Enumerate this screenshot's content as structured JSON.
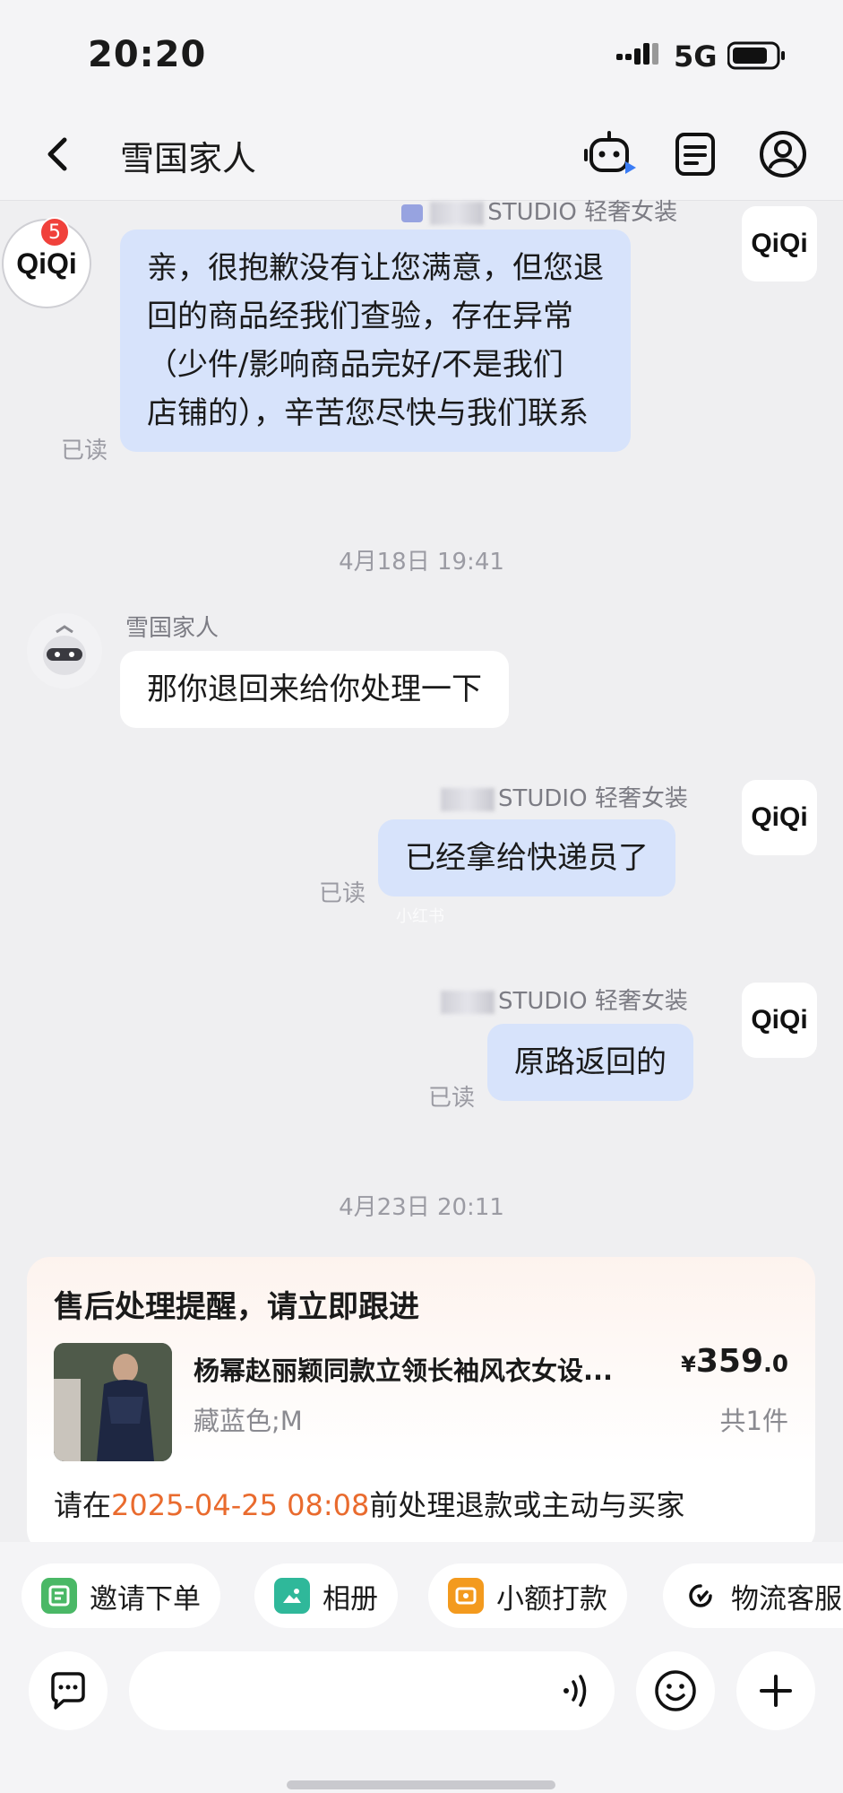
{
  "status_bar": {
    "time": "20:20",
    "network": "5G"
  },
  "nav": {
    "title": "雪国家人"
  },
  "messages": {
    "m1": {
      "sender": "STUDIO 轻奢女装",
      "avatar": "QiQi",
      "badge": "5",
      "text": [
        "亲，很抱歉没有让您满意，但您退",
        "回的商品经我们查验，存在异常",
        "（少件/影响商品完好/不是我们",
        "店铺的），辛苦您尽快与我们联系"
      ],
      "read": "已读"
    },
    "time1": "4月18日 19:41",
    "m2": {
      "sender": "雪国家人",
      "text": "那你退回来给你处理一下"
    },
    "m3": {
      "sender": "STUDIO 轻奢女装",
      "avatar": "QiQi",
      "text": "已经拿给快递员了",
      "read": "已读"
    },
    "watermark": "小红书",
    "m4": {
      "sender": "STUDIO 轻奢女装",
      "avatar": "QiQi",
      "text": "原路返回的",
      "read": "已读"
    },
    "time2": "4月23日 20:11"
  },
  "card": {
    "title": "售后处理提醒，请立即跟进",
    "product_name": "杨幂赵丽颖同款立领长袖风衣女设...",
    "price_symbol": "¥",
    "price_int": "359",
    "price_dec": ".0",
    "spec": "藏蓝色;M",
    "qty": "共1件",
    "body_prefix": "请在",
    "deadline": "2025-04-25 08:08",
    "body_suffix": "前处理退款或主动与买家"
  },
  "quick_actions": [
    "邀请下单",
    "相册",
    "小额打款",
    "物流客服"
  ]
}
